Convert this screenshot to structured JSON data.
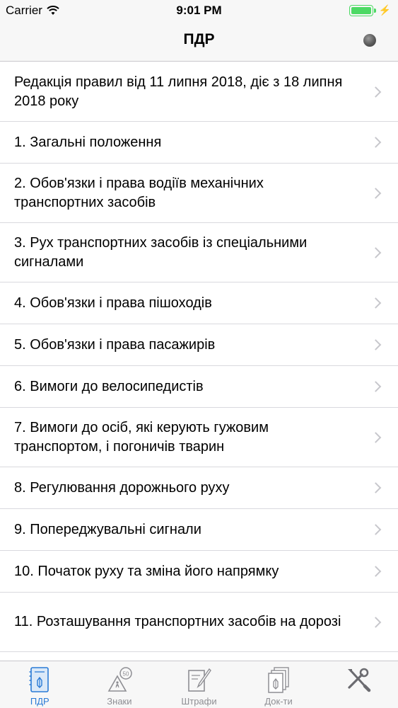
{
  "status_bar": {
    "carrier": "Carrier",
    "time": "9:01 PM",
    "charging_symbol": "⚡"
  },
  "nav": {
    "title": "ПДР"
  },
  "list": {
    "items": [
      {
        "label": "Редакція правил від 11 липня 2018, діє з  18 липня 2018 року"
      },
      {
        "label": "1. Загальні положення"
      },
      {
        "label": "2. Обов'язки і права водіїв механічних транспортних засобів"
      },
      {
        "label": "3. Рух транспортних засобів із спеціальними сигналами"
      },
      {
        "label": "4. Обов'язки і права пішоходів"
      },
      {
        "label": "5. Обов'язки і права пасажирів"
      },
      {
        "label": "6. Вимоги до велосипедистів"
      },
      {
        "label": "7. Вимоги до осіб, які керують гужовим транспортом, і погоничів тварин"
      },
      {
        "label": "8. Регулювання дорожнього руху"
      },
      {
        "label": "9. Попереджувальні сигнали"
      },
      {
        "label": "10. Початок руху та зміна його напрямку"
      },
      {
        "label": "11. Розташування транспортних засобів на дорозі"
      }
    ]
  },
  "tab_bar": {
    "tabs": [
      {
        "label": "ПДР",
        "icon": "rulebook-icon",
        "active": true
      },
      {
        "label": "Знаки",
        "icon": "road-sign-icon",
        "active": false
      },
      {
        "label": "Штрафи",
        "icon": "fine-document-icon",
        "active": false
      },
      {
        "label": "Док-ти",
        "icon": "documents-icon",
        "active": false
      },
      {
        "label": "",
        "icon": "tools-icon",
        "active": false
      }
    ],
    "active_color": "#2a7bd6",
    "inactive_color": "#8e8e93"
  },
  "colors": {
    "battery": "#4cd964"
  }
}
